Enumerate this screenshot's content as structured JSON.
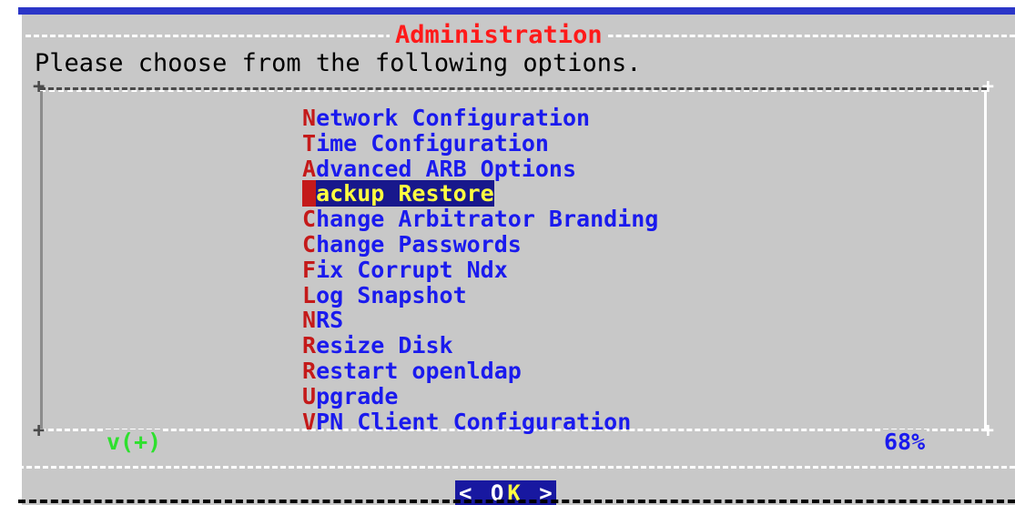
{
  "dialog": {
    "title": "Administration",
    "prompt": "Please choose from the following options."
  },
  "menu": {
    "items": [
      {
        "hotkey": "N",
        "rest": "etwork Configuration"
      },
      {
        "hotkey": "T",
        "rest": "ime Configuration"
      },
      {
        "hotkey": "A",
        "rest": "dvanced ARB Options"
      },
      {
        "hotkey": "B",
        "rest": "ackup Restore",
        "selected": true
      },
      {
        "hotkey": "C",
        "rest": "hange Arbitrator Branding"
      },
      {
        "hotkey": "C",
        "rest": "hange Passwords"
      },
      {
        "hotkey": "F",
        "rest": "ix Corrupt Ndx"
      },
      {
        "hotkey": "L",
        "rest": "og Snapshot"
      },
      {
        "hotkey": "N",
        "rest": "RS"
      },
      {
        "hotkey": "R",
        "rest": "esize Disk"
      },
      {
        "hotkey": "R",
        "rest": "estart openldap"
      },
      {
        "hotkey": "U",
        "rest": "pgrade"
      },
      {
        "hotkey": "V",
        "rest": "PN Client Configuration"
      }
    ],
    "scroll_indicator": "v(+)",
    "scroll_percent": "68%"
  },
  "buttons": {
    "ok_left_bracket": "<",
    "ok_o": "O",
    "ok_k": "K",
    "ok_right_bracket": ">"
  },
  "colors": {
    "title": "#ff1a1a",
    "menu_text": "#1a1aee",
    "hotkey": "#c41a1a",
    "selected_bg": "#18188c",
    "selected_fg": "#ffff40",
    "scroll_indicator": "#2ee02e",
    "dialog_bg": "#c8c8c8",
    "border_top": "#2b36c8"
  }
}
